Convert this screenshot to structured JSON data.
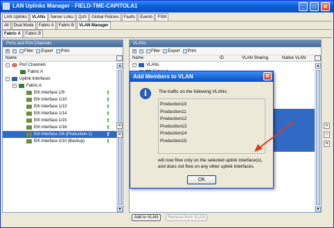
{
  "window": {
    "title": "LAN Uplinks Manager - FIELD-TME-CAPITOLA1",
    "minimize_glyph": "_",
    "maximize_glyph": "□",
    "close_glyph": "✕"
  },
  "main_tabs": [
    "LAN Uplinks",
    "VLANs",
    "Server Links",
    "QoS",
    "Global Policies",
    "Faults",
    "Events",
    "FSM"
  ],
  "sub_tabs": [
    "All",
    "Dual Mode",
    "Fabric A",
    "Fabric B",
    "VLAN Manager"
  ],
  "fabric_tabs": [
    "Fabric A",
    "Fabric B"
  ],
  "left_panel": {
    "header": "Ports and Port Channels",
    "toolbar": {
      "add": "+",
      "remove": "−",
      "filter": "Filter",
      "export": "Export",
      "print": "Print"
    },
    "columns": {
      "name": "Name"
    },
    "tree": [
      {
        "label": "Port Channels",
        "level": 0,
        "expander": "−",
        "icon": "port-channels-icon"
      },
      {
        "label": "Fabric A",
        "level": 1,
        "icon": "fabric-icon"
      },
      {
        "label": "Uplink Interfaces",
        "level": 0,
        "expander": "−",
        "icon": "uplink-interfaces-icon"
      },
      {
        "label": "Fabric A",
        "level": 1,
        "expander": "−",
        "icon": "fabric-icon"
      },
      {
        "label": "Eth Interface 1/9",
        "level": 2,
        "icon": "eth-interface-icon",
        "uplink": "⇧"
      },
      {
        "label": "Eth Interface 1/10",
        "level": 2,
        "icon": "eth-interface-icon",
        "uplink": "⇧"
      },
      {
        "label": "Eth Interface 1/13",
        "level": 2,
        "icon": "eth-interface-icon",
        "uplink": "⇧"
      },
      {
        "label": "Eth Interface 1/14",
        "level": 2,
        "icon": "eth-interface-icon",
        "uplink": "⇧"
      },
      {
        "label": "Eth Interface 1/15",
        "level": 2,
        "icon": "eth-interface-icon",
        "uplink": "⇧"
      },
      {
        "label": "Eth Interface 1/16",
        "level": 2,
        "icon": "eth-interface-icon",
        "uplink": "⇧"
      },
      {
        "label": "Eth Interface 2/6 (Production-1)",
        "level": 2,
        "icon": "eth-interface-icon",
        "uplink": "⇧",
        "selected": true
      },
      {
        "label": "Eth Interface 2/10 (Backup)",
        "level": 2,
        "icon": "eth-interface-icon",
        "uplink": "⇧"
      }
    ]
  },
  "right_panel": {
    "header": "VLANs",
    "toolbar": {
      "add": "+",
      "remove": "−",
      "filter": "Filter",
      "export": "Export",
      "print": "Print"
    },
    "columns": {
      "name": "Name",
      "id": "ID",
      "sharing": "VLAN Sharing",
      "native": "Native VLAN"
    },
    "tree": [
      {
        "label": "VLANs",
        "expander": "−"
      },
      {
        "label": "Fabric A",
        "expander": "+"
      }
    ]
  },
  "side_controls": {
    "add": "+",
    "remove": "−",
    "details": "≡"
  },
  "scroll_glyphs": {
    "up": "▲",
    "down": "▼"
  },
  "bottom": {
    "add_to_vlan": "Add to VLAN",
    "remove_from_vlan": "Remove from VLAN"
  },
  "dialog": {
    "title": "Add Members to VLAN",
    "icon": "i",
    "close_glyph": "✕",
    "message": "The traffic on the following VLANs:",
    "vlans": [
      "Production10",
      "Production11",
      "Production12",
      "Production13",
      "Production14",
      "Production15"
    ],
    "footer_line1": "will now flow only on the selected uplink interface(s),",
    "footer_line2": "and does not flow on any other uplink interfaces.",
    "ok": "OK"
  },
  "colors": {
    "titlebar": "#0a5fd8",
    "selection": "#316ac5",
    "annotation_arrow": "#e03a1c",
    "uplink_green": "#2e8b2e"
  }
}
